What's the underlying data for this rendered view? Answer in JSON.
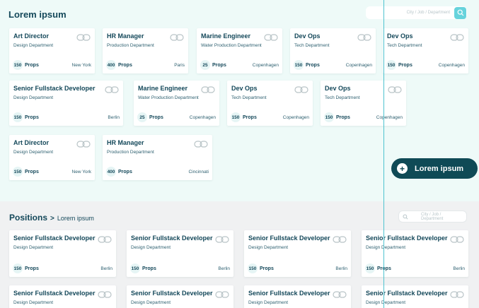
{
  "header": {
    "title": "Lorem ipsum"
  },
  "search_top": {
    "placeholder": "City / Job / Department",
    "icon": "search-icon"
  },
  "search_bottom": {
    "placeholder": "City / Job / Department",
    "icon": "search-icon"
  },
  "cta": {
    "label": "Lorem ipsum",
    "icon": "plus-icon"
  },
  "positions": {
    "title": "Positions",
    "separator": ">",
    "subtitle": "Lorem ipsum"
  },
  "props_label": "Props",
  "top_cards": [
    {
      "title": "Art Director",
      "dept": "Design Department",
      "count": "150",
      "city": "New York"
    },
    {
      "title": "HR Manager",
      "dept": "Production Department",
      "count": "400",
      "city": "Paris"
    },
    {
      "title": "Marine Engineer",
      "dept": "Water Production Department",
      "count": "25",
      "city": "Copenhagen"
    },
    {
      "title": "Dev Ops",
      "dept": "Tech Department",
      "count": "150",
      "city": "Copenhagen"
    },
    {
      "title": "Dev Ops",
      "dept": "Tech Department",
      "count": "150",
      "city": "Copenhagen"
    },
    {
      "title": "Senior Fullstack Developer",
      "dept": "Design Department",
      "count": "150",
      "city": "Berlin"
    },
    {
      "title": "Marine Engineer",
      "dept": "Water Production Department",
      "count": "25",
      "city": "Copenhagen"
    },
    {
      "title": "Dev Ops",
      "dept": "Tech Department",
      "count": "150",
      "city": "Copenhagen"
    },
    {
      "title": "Dev Ops",
      "dept": "Tech Department",
      "count": "150",
      "city": "Copenhagen"
    },
    {
      "title": "Art Director",
      "dept": "Design Department",
      "count": "150",
      "city": "New York"
    },
    {
      "title": "HR Manager",
      "dept": "Production Department",
      "count": "400",
      "city": "Cincinnati"
    }
  ],
  "bottom_cards": [
    {
      "title": "Senior Fullstack Developer",
      "dept": "Design Department",
      "count": "150",
      "city": "Berlin"
    },
    {
      "title": "Senior Fullstack Developer",
      "dept": "Design Department",
      "count": "150",
      "city": "Berlin"
    },
    {
      "title": "Senior Fullstack Developer",
      "dept": "Design Department",
      "count": "150",
      "city": "Berlin"
    },
    {
      "title": "Senior Fullstack Developer",
      "dept": "Design Department",
      "count": "150",
      "city": "Berlin"
    },
    {
      "title": "Senior Fullstack Developer",
      "dept": "Design Department",
      "count": "",
      "city": ""
    },
    {
      "title": "Senior Fullstack Developer",
      "dept": "Design Department",
      "count": "",
      "city": ""
    },
    {
      "title": "Senior Fullstack Developer",
      "dept": "Design Department",
      "count": "",
      "city": ""
    },
    {
      "title": "Senior Fullstack Developer",
      "dept": "Design Department",
      "count": "",
      "city": ""
    }
  ],
  "colors": {
    "primary": "#0f4a56",
    "accent": "#66d3dc",
    "guide": "#4fc3cf"
  }
}
